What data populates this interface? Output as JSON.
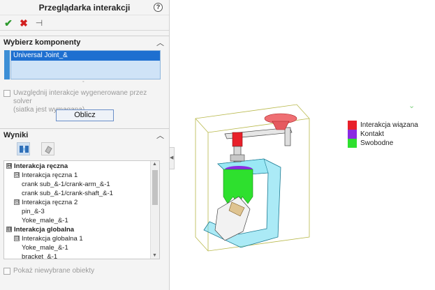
{
  "panel": {
    "title": "Przeglądarka interakcji",
    "help_glyph": "?",
    "actions": {
      "ok_glyph": "✔",
      "cancel_glyph": "✖",
      "pin_glyph": "⊣"
    },
    "select_section": {
      "label": "Wybierz komponenty",
      "selected_item": "Universal Joint_&",
      "include_solver_label": "Uwzględnij interakcje wygenerowane przez solver",
      "include_solver_note": "(siatka jest wymagana)",
      "include_solver_checked": false,
      "calculate_label": "Oblicz"
    },
    "results_section": {
      "label": "Wyniki",
      "tree": [
        {
          "text": "Interakcja ręczna",
          "level": 0,
          "bold": true,
          "expander": "⊟"
        },
        {
          "text": "Interakcja ręczna 1",
          "level": 1,
          "bold": false,
          "expander": "⊟"
        },
        {
          "text": "crank sub_&-1/crank-arm_&-1",
          "level": 2,
          "bold": false,
          "expander": ""
        },
        {
          "text": "crank sub_&-1/crank-shaft_&-1",
          "level": 2,
          "bold": false,
          "expander": ""
        },
        {
          "text": "Interakcja ręczna 2",
          "level": 1,
          "bold": false,
          "expander": "⊟"
        },
        {
          "text": "pin_&-3",
          "level": 2,
          "bold": false,
          "expander": ""
        },
        {
          "text": "Yoke_male_&-1",
          "level": 2,
          "bold": false,
          "expander": ""
        },
        {
          "text": "Interakcja globalna",
          "level": 0,
          "bold": true,
          "expander": "⊟"
        },
        {
          "text": "Interakcja globalna 1",
          "level": 1,
          "bold": false,
          "expander": "⊟"
        },
        {
          "text": "Yoke_male_&-1",
          "level": 2,
          "bold": false,
          "expander": ""
        },
        {
          "text": "bracket_&-1",
          "level": 2,
          "bold": false,
          "expander": ""
        }
      ]
    },
    "show_unselected_label": "Pokaż niewybrane obiekty",
    "show_unselected_checked": false
  },
  "legend": [
    {
      "label": "Interakcja wiązana",
      "color": "#e8202a"
    },
    {
      "label": "Kontakt",
      "color": "#8a2be2"
    },
    {
      "label": "Swobodne",
      "color": "#2ee02e"
    }
  ],
  "colors": {
    "accent": "#1e6fd0",
    "part_transparent": "#66d8ee",
    "bonded": "#e8202a",
    "contact": "#8a2be2",
    "free": "#2ee02e"
  },
  "icons": {
    "help": "help-icon",
    "ok": "checkmark-icon",
    "cancel": "close-icon",
    "pin": "pushpin-icon",
    "chevron": "chevron-up-icon",
    "tool_a": "interaction-view-icon",
    "tool_b": "reset-view-icon"
  }
}
